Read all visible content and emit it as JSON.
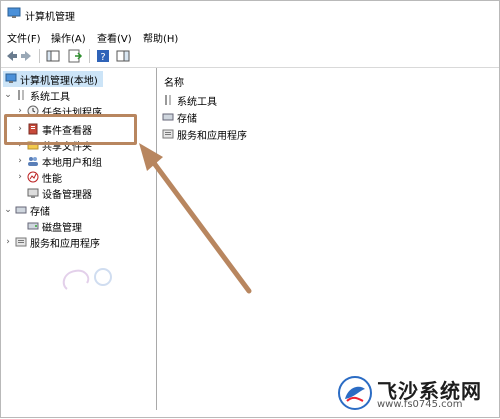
{
  "window": {
    "title": "计算机管理"
  },
  "menu": [
    "文件(F)",
    "操作(A)",
    "查看(V)",
    "帮助(H)"
  ],
  "tree": {
    "root": "计算机管理(本地)",
    "system_tools": "系统工具",
    "items": [
      "任务计划程序",
      "事件查看器",
      "共享文件夹",
      "本地用户和组",
      "性能",
      "设备管理器"
    ],
    "storage": "存储",
    "disk_mgmt": "磁盘管理",
    "services": "服务和应用程序"
  },
  "right": {
    "column_header": "名称",
    "rows": [
      "系统工具",
      "存储",
      "服务和应用程序"
    ]
  },
  "watermark": {
    "brand": "飞沙系统网",
    "url": "www.fs0745.com"
  },
  "colors": {
    "annotation": "#b8865f",
    "selection": "#cce4f7"
  }
}
